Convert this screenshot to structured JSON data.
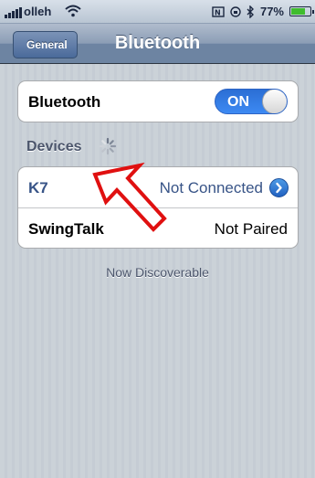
{
  "status_bar": {
    "carrier": "olleh",
    "battery": "77%",
    "battery_level": 0.77
  },
  "nav": {
    "back_label": "General",
    "title": "Bluetooth"
  },
  "bluetooth_toggle": {
    "label": "Bluetooth",
    "state": "ON"
  },
  "devices": {
    "header": "Devices",
    "items": [
      {
        "name": "K7",
        "status": "Not Connected"
      },
      {
        "name": "SwingTalk",
        "status": "Not Paired"
      }
    ]
  },
  "footer": "Now Discoverable",
  "colors": {
    "accent": "#2b6ed4",
    "link_text": "#385487",
    "annotation": "#e01010"
  }
}
